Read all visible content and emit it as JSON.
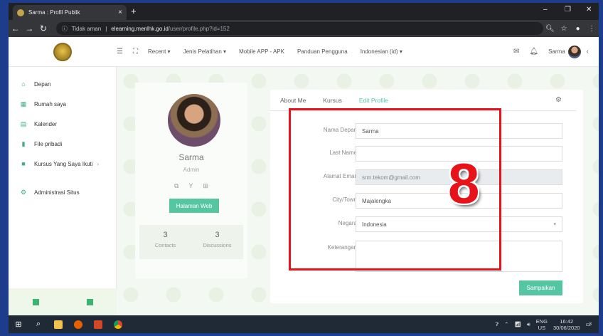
{
  "browser": {
    "tab_title": "Sarma : Profil Publik",
    "tab_close": "×",
    "new_tab": "+",
    "window_controls": [
      "–",
      "❐",
      "✕"
    ],
    "security_label": "Tidak aman",
    "url_host": "elearning.menlhk.go.id",
    "url_path": "/user/profile.php?id=152"
  },
  "navbar": {
    "menu": [
      "Recent ▾",
      "Jenis Pelatihan ▾",
      "Mobile APP - APK",
      "Panduan Pengguna",
      "Indonesian (id) ▾"
    ],
    "username": "Sarma",
    "collapse_glyph": "‹"
  },
  "sidebar": {
    "items": [
      {
        "label": "Depan",
        "icon": "home-icon"
      },
      {
        "label": "Rumah saya",
        "icon": "dashboard-icon"
      },
      {
        "label": "Kalender",
        "icon": "calendar-icon"
      },
      {
        "label": "File pribadi",
        "icon": "file-icon"
      },
      {
        "label": "Kursus Yang Saya Ikuti",
        "icon": "courses-icon",
        "chevron": "›"
      },
      {
        "label": "Administrasi Situs",
        "icon": "gear-icon"
      }
    ]
  },
  "profile": {
    "name": "Sarma",
    "role": "Admin",
    "web_button": "Halaman Web",
    "stats": [
      {
        "value": "3",
        "label": "Contacts"
      },
      {
        "value": "3",
        "label": "Discussions"
      }
    ]
  },
  "tabs": [
    "About Me",
    "Kursus",
    "Edit Profile"
  ],
  "form": {
    "first_name_label": "Nama Depan",
    "first_name_value": "Sarma",
    "last_name_label": "Last Name",
    "last_name_value": "",
    "email_label": "Alamat Email",
    "email_value": "srm.tekom@gmail.com",
    "city_label": "City/Town",
    "city_value": "Majalengka",
    "country_label": "Negara",
    "country_value": "Indonesia",
    "description_label": "Keterangan",
    "description_value": "",
    "submit_label": "Sampaikan"
  },
  "annotation": {
    "step_number": "8",
    "color": "#e8121a"
  },
  "taskbar": {
    "language_top": "ENG",
    "language_bottom": "US",
    "time": "16:42",
    "date": "30/06/2020",
    "notification_count": "3"
  },
  "colors": {
    "accent": "#56c6a2",
    "highlight": "#e8121a",
    "browser_dark": "#202124"
  }
}
